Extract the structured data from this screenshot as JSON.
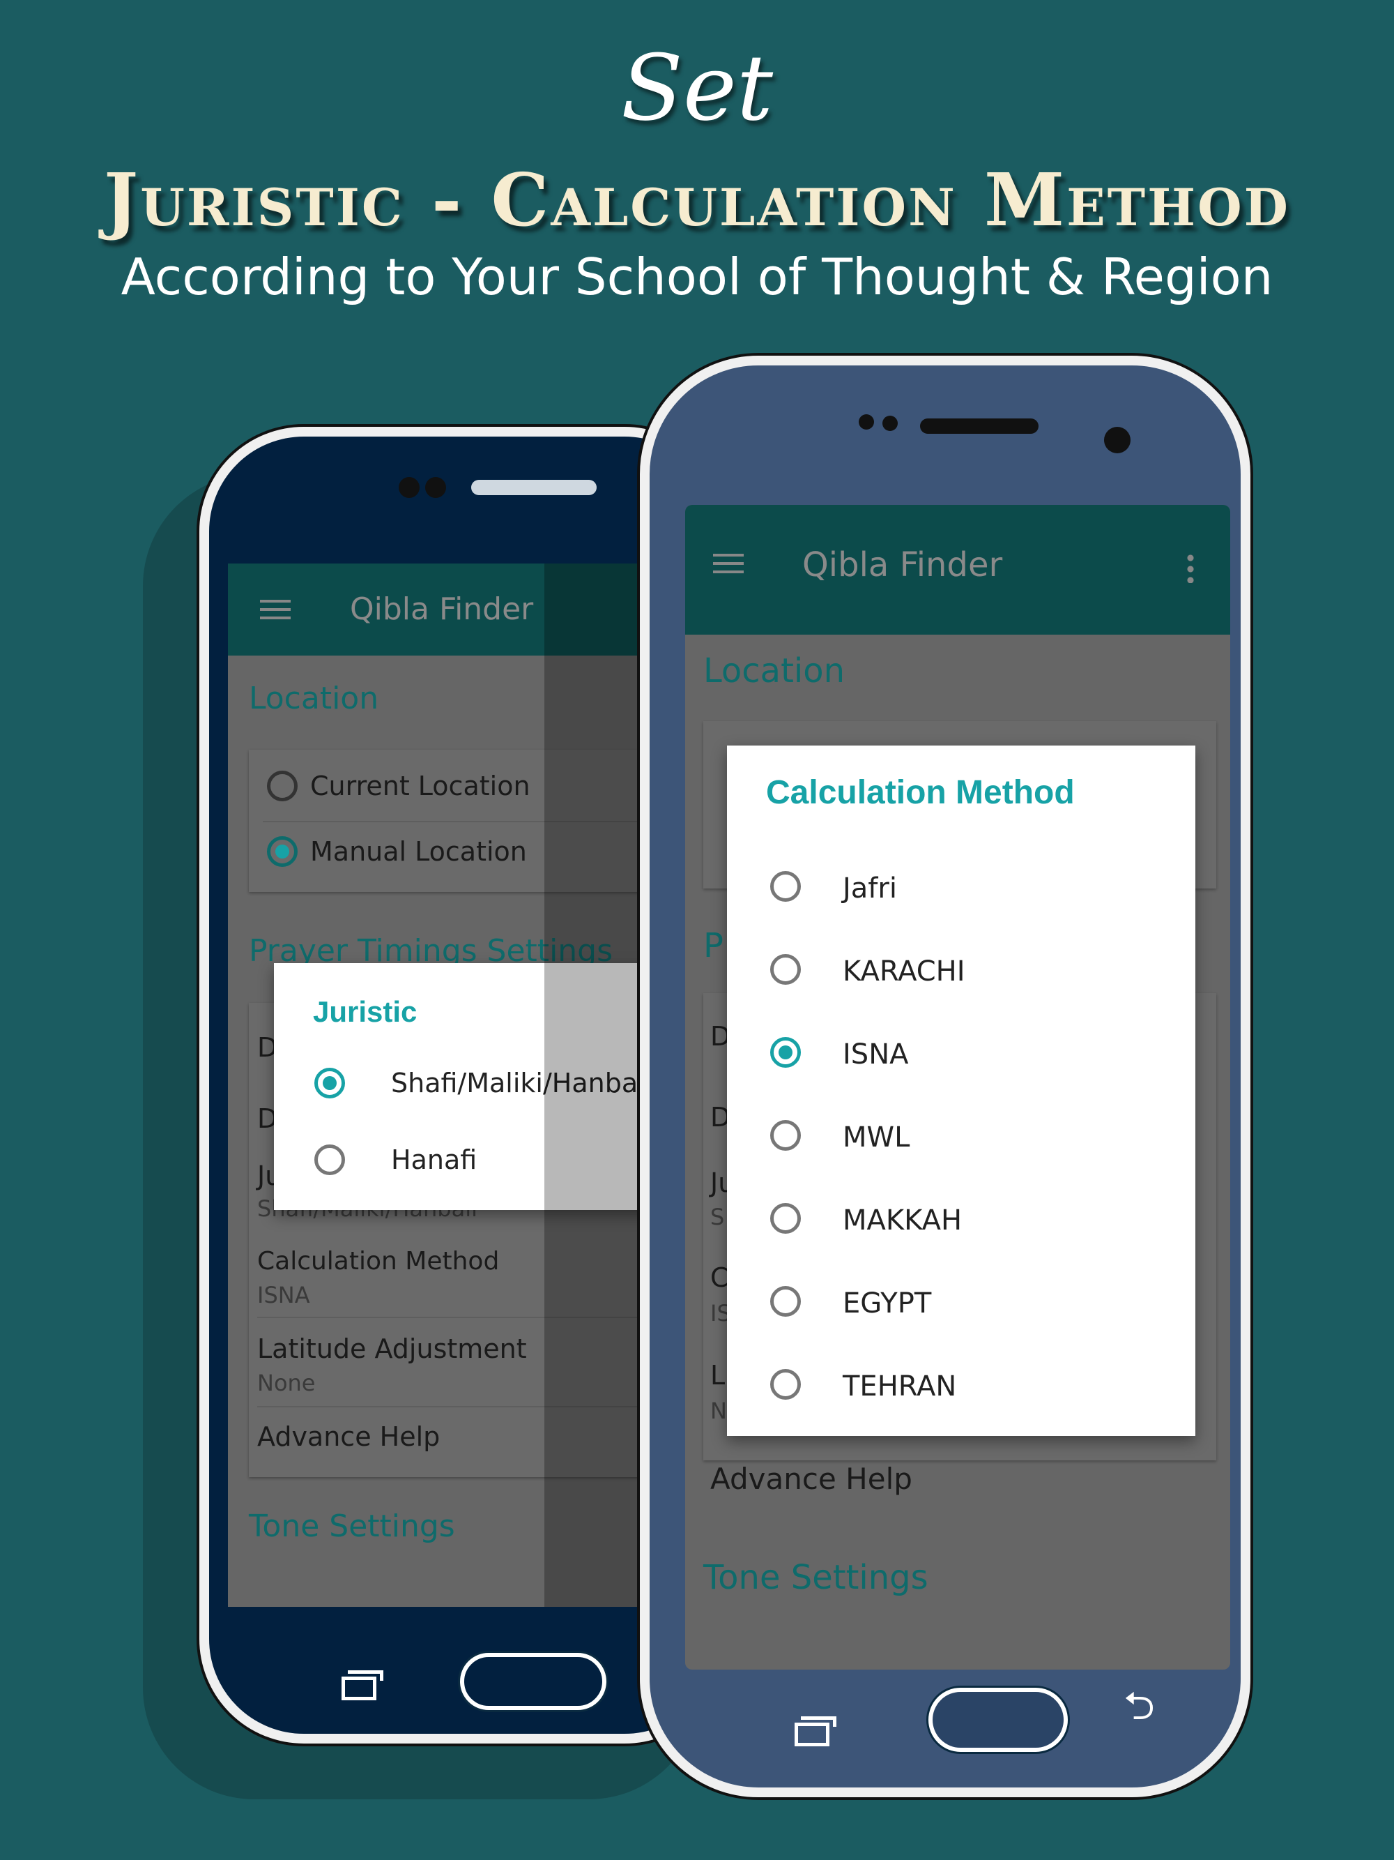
{
  "banner": {
    "set": "Set",
    "title": "Juristic - Calculation Method",
    "subtitle": "According to Your School of Thought & Region"
  },
  "colors": {
    "background": "#1b5c61",
    "accent": "#17a2a6",
    "header": "#0c4b4b",
    "left_bezel": "#02203f",
    "right_bezel": "#3d5578"
  },
  "left_phone": {
    "app_title": "Qibla Finder",
    "location_header": "Location",
    "location_options": [
      {
        "label": "Current Location",
        "selected": false
      },
      {
        "label": "Manual Location",
        "selected": true
      }
    ],
    "prayer_header": "Prayer Timings Settings",
    "rows": [
      {
        "title": "D"
      },
      {
        "title": "D"
      },
      {
        "title": "Ju",
        "value": "Shafi/Maliki/Hanbali"
      },
      {
        "title": "Calculation Method",
        "value": "ISNA"
      },
      {
        "title": "Latitude Adjustment",
        "value": "None"
      },
      {
        "title": "Advance Help"
      }
    ],
    "tone_header": "Tone Settings",
    "dialog": {
      "title": "Juristic",
      "options": [
        {
          "label": "Shafi/Maliki/Hanbali",
          "selected": true
        },
        {
          "label": "Hanafi",
          "selected": false
        }
      ]
    }
  },
  "right_phone": {
    "app_title": "Qibla Finder",
    "location_header": "Location",
    "prayer_header_partial": "P",
    "rows": [
      {
        "title": "D"
      },
      {
        "title": "D"
      },
      {
        "title": "Ju",
        "value": "S"
      },
      {
        "title": "C",
        "value": "IS"
      },
      {
        "title": "L",
        "value": "N"
      },
      {
        "title": "Advance Help"
      }
    ],
    "tone_header": "Tone Settings",
    "dialog": {
      "title": "Calculation Method",
      "options": [
        {
          "label": "Jafri",
          "selected": false
        },
        {
          "label": "KARACHI",
          "selected": false
        },
        {
          "label": "ISNA",
          "selected": true
        },
        {
          "label": "MWL",
          "selected": false
        },
        {
          "label": "MAKKAH",
          "selected": false
        },
        {
          "label": "EGYPT",
          "selected": false
        },
        {
          "label": "TEHRAN",
          "selected": false
        }
      ]
    }
  }
}
